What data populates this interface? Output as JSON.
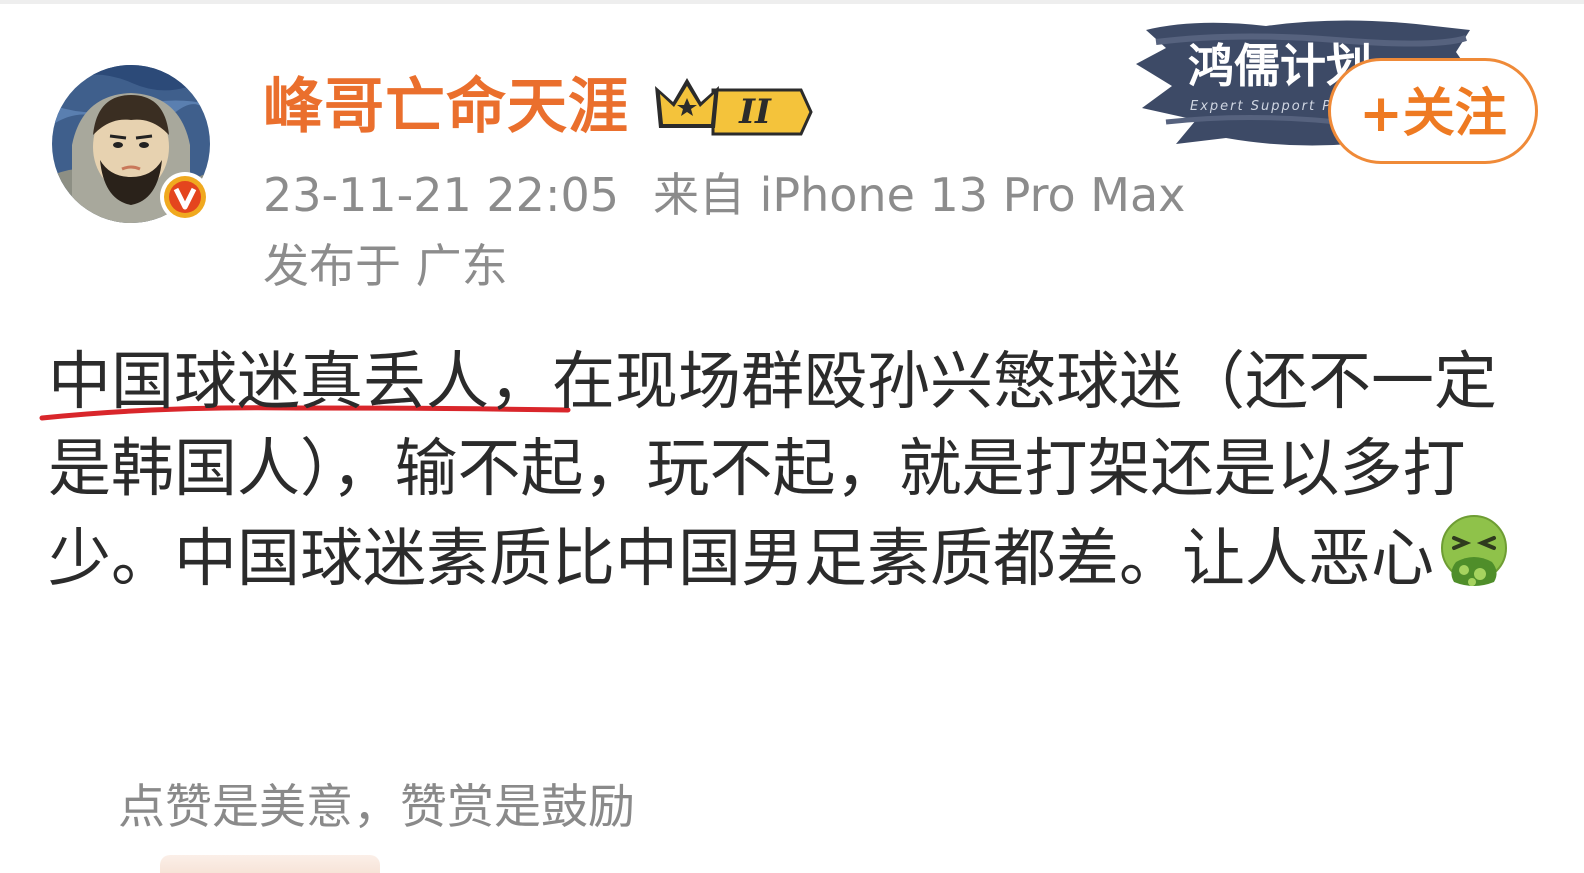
{
  "author": {
    "name": "峰哥亡命天涯",
    "avatar_icon": "cartoon-bearded-man-avatar",
    "verified_badge": "V",
    "level_badge": "II"
  },
  "meta": {
    "timestamp": "23-11-21 22:05",
    "source": "来自 iPhone 13 Pro Max",
    "location": "发布于 广东"
  },
  "banner": {
    "title": "鸿儒计划",
    "subtitle": "Expert Support Pro"
  },
  "follow_button": {
    "label": "+关注"
  },
  "post": {
    "text_underlined": "中国球迷真丢人，",
    "text_rest": "在现场群殴孙兴慜球迷（还不一定是韩国人），输不起，玩不起，就是打架还是以多打少。中国球迷素质比中国男足素质都差。让人恶心",
    "emoji": "nauseated-face-emoji"
  },
  "tip": {
    "text": "点赞是美意，赞赏是鼓励"
  },
  "colors": {
    "username": "#ea6f2d",
    "follow_border": "#ef8a38",
    "meta_gray": "#8c8c8c",
    "underline_red": "#d9262b"
  }
}
